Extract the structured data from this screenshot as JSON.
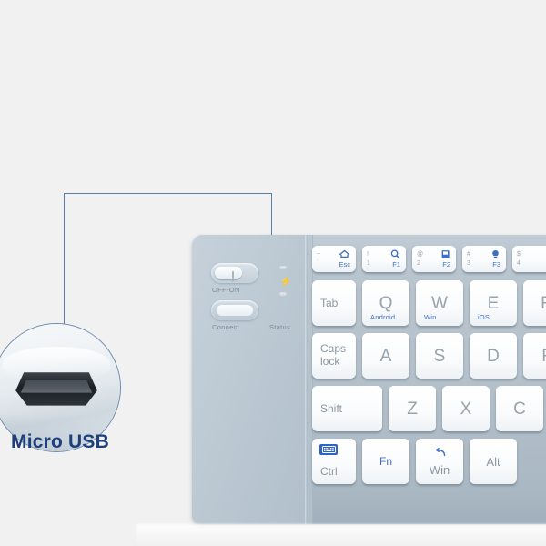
{
  "background_color": "#f1f1f1",
  "callout": {
    "label": "Micro USB",
    "label_color": "#1f3f7a",
    "line_color": "#5b7ea6",
    "magnifier": {
      "subject": "micro-usb-port",
      "description": "Close-up of micro USB charging port"
    }
  },
  "keyboard": {
    "body_color": "#b4c1cb",
    "key_color": "#ffffff",
    "key_text_color": "#8d98a2",
    "accent_color": "#3f6fc4",
    "controls": {
      "power_switch_label": "OFF-ON",
      "connect_button_label": "Connect",
      "status_label": "Status",
      "status_indicators": [
        "led-top",
        "battery-bolt",
        "led-bottom"
      ]
    },
    "rows": [
      {
        "name": "function-row",
        "keys": [
          {
            "name": "esc",
            "type": "fkey",
            "tl": "~",
            "bl": "`",
            "icon": "home-icon",
            "br": "Esc"
          },
          {
            "name": "f1",
            "type": "fkey",
            "tl": "!",
            "bl": "1",
            "icon": "search-icon",
            "br": "F1"
          },
          {
            "name": "f2",
            "type": "fkey",
            "tl": "@",
            "bl": "2",
            "icon": "screen-icon",
            "br": "F2"
          },
          {
            "name": "f3",
            "type": "fkey",
            "tl": "#",
            "bl": "3",
            "icon": "bulb-icon",
            "br": "F3"
          },
          {
            "name": "f4",
            "type": "fkey",
            "tl": "$",
            "bl": "4",
            "icon": "",
            "br": ""
          }
        ]
      },
      {
        "name": "qwerty-row",
        "keys": [
          {
            "name": "tab",
            "type": "mod",
            "label": "Tab"
          },
          {
            "name": "q",
            "type": "letter",
            "label": "Q",
            "sub": "Android"
          },
          {
            "name": "w",
            "type": "letter",
            "label": "W",
            "sub": "Win"
          },
          {
            "name": "e",
            "type": "letter",
            "label": "E",
            "sub": "iOS"
          },
          {
            "name": "r",
            "type": "letter",
            "label": "R",
            "sub": ""
          }
        ]
      },
      {
        "name": "home-row",
        "keys": [
          {
            "name": "caps-lock",
            "type": "mod2",
            "label1": "Caps",
            "label2": "lock"
          },
          {
            "name": "a",
            "type": "letter",
            "label": "A"
          },
          {
            "name": "s",
            "type": "letter",
            "label": "S"
          },
          {
            "name": "d",
            "type": "letter",
            "label": "D"
          },
          {
            "name": "f",
            "type": "letter",
            "label": "F"
          }
        ]
      },
      {
        "name": "shift-row",
        "keys": [
          {
            "name": "shift",
            "type": "mod",
            "label": "Shift"
          },
          {
            "name": "z",
            "type": "letter",
            "label": "Z"
          },
          {
            "name": "x",
            "type": "letter",
            "label": "X"
          },
          {
            "name": "c",
            "type": "letter",
            "label": "C"
          }
        ]
      },
      {
        "name": "bottom-row",
        "keys": [
          {
            "name": "ctrl",
            "type": "ctrl",
            "label": "Ctrl",
            "icon": "keyboard-icon"
          },
          {
            "name": "fn",
            "type": "fn",
            "label": "Fn"
          },
          {
            "name": "win",
            "type": "win",
            "label": "Win",
            "icon": "back-arrow-icon"
          },
          {
            "name": "alt",
            "type": "letter-small",
            "label": "Alt"
          }
        ]
      }
    ]
  }
}
